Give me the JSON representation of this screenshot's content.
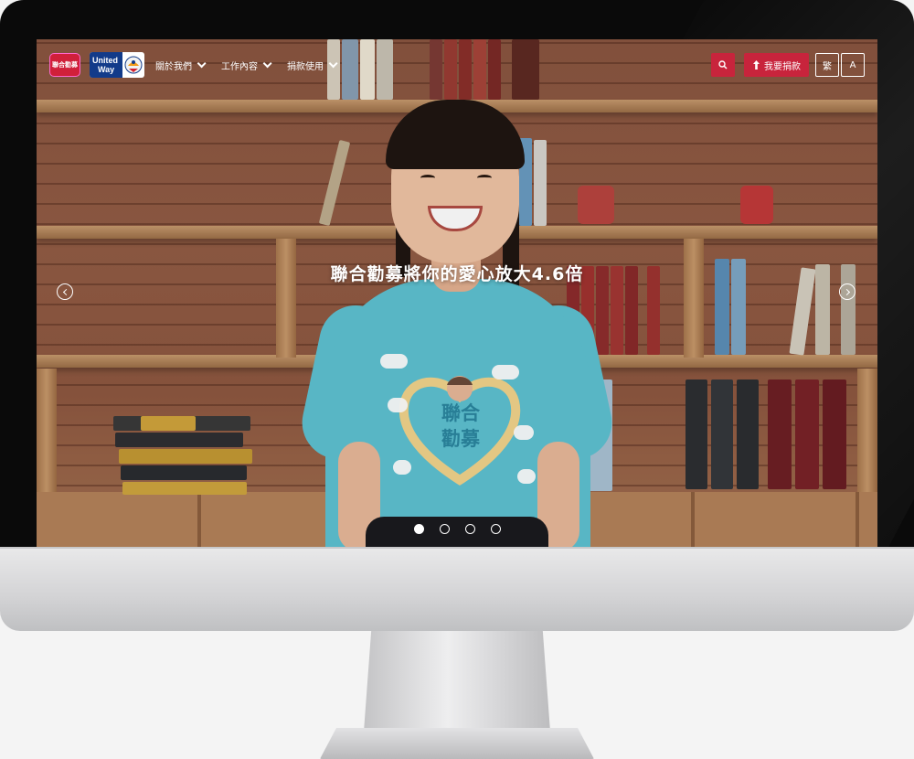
{
  "header": {
    "logo_red_text": "聯合勸募",
    "logo_uw_line1": "United",
    "logo_uw_line2": "Way",
    "nav": [
      {
        "label": "關於我們"
      },
      {
        "label": "工作內容"
      },
      {
        "label": "捐款使用"
      }
    ],
    "search_icon": "search-icon",
    "donate_label": "我要捐款",
    "lang_label": "繁",
    "font_label": "A"
  },
  "hero": {
    "title": "聯合勸募將你的愛心放大4.6倍",
    "shirt_text_line1": "聯合",
    "shirt_text_line2": "勸募",
    "slide_count": 4,
    "active_slide": 1
  },
  "colors": {
    "accent": "#c8243c",
    "shirt": "#5ec2d2",
    "uw_blue": "#123b8a"
  }
}
